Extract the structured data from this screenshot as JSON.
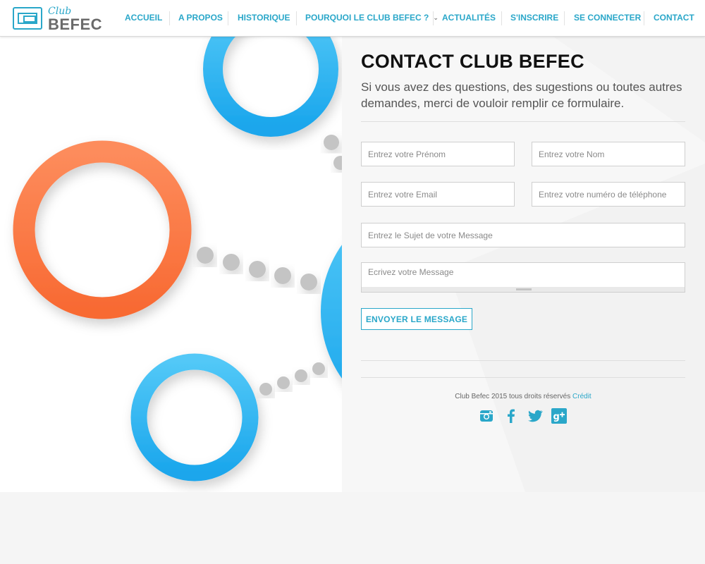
{
  "brand": {
    "club": "Club",
    "name": "BEFEC"
  },
  "nav": [
    {
      "label": "ACCUEIL"
    },
    {
      "label": "A PROPOS"
    },
    {
      "label": "HISTORIQUE"
    },
    {
      "label": "POURQUOI LE CLUB BEFEC ?",
      "has_dropdown": true
    },
    {
      "label": "ACTUALITÉS"
    },
    {
      "label": "S'INSCRIRE"
    },
    {
      "label": "SE CONNECTER"
    },
    {
      "label": "CONTACT"
    }
  ],
  "contact": {
    "title": "CONTACT CLUB BEFEC",
    "subtitle": "Si vous avez des questions, des sugestions ou toutes autres demandes, merci de vouloir remplir ce formulaire.",
    "fields": {
      "prenom_placeholder": "Entrez votre Prénom",
      "nom_placeholder": "Entrez votre Nom",
      "email_placeholder": "Entrez votre Email",
      "phone_placeholder": "Entrez votre numéro de téléphone",
      "sujet_placeholder": "Entrez le Sujet de votre Message",
      "message_placeholder": "Ecrivez votre Message"
    },
    "send_label": "ENVOYER LE MESSAGE"
  },
  "footer": {
    "copyright": "Club Befec 2015 tous droits réservés",
    "credit_link": "Crédit",
    "socials": [
      "instagram-icon",
      "facebook-icon",
      "twitter-icon",
      "google-plus-icon"
    ]
  },
  "colors": {
    "accent": "#2aa7c9",
    "orange": "#fb7a45",
    "blue": "#31b5ef",
    "dot": "#c4c4c4"
  }
}
